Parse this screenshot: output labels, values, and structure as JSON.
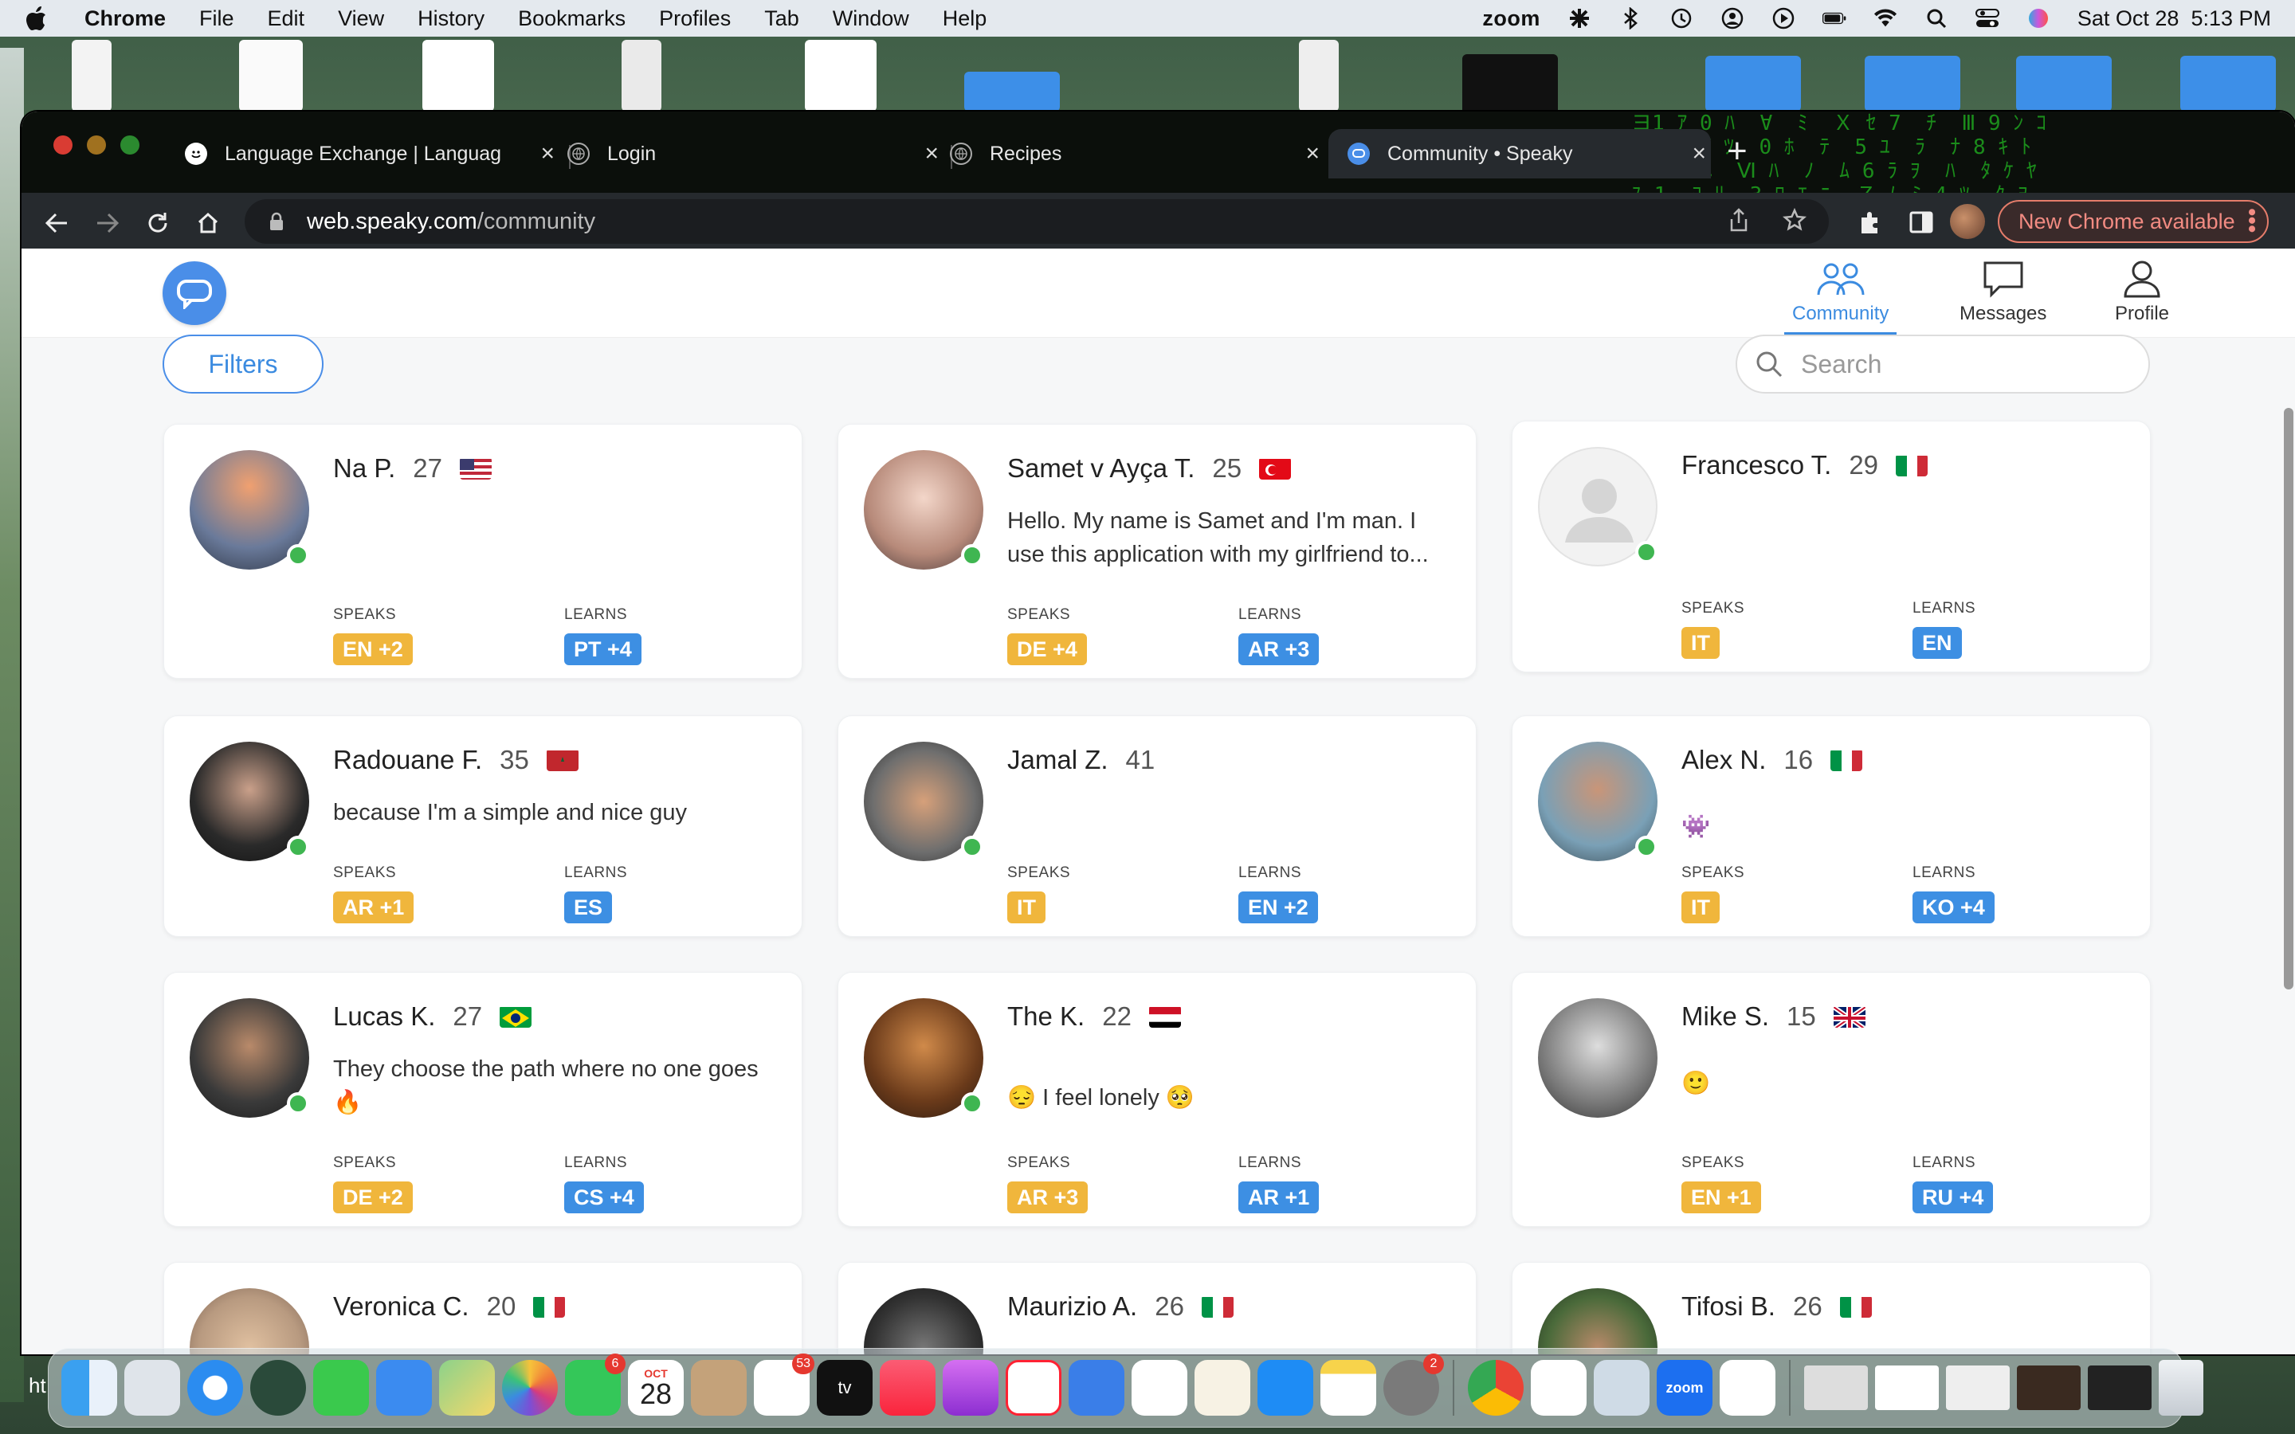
{
  "menubar": {
    "app": "Chrome",
    "items": [
      "File",
      "Edit",
      "View",
      "History",
      "Bookmarks",
      "Profiles",
      "Tab",
      "Window",
      "Help"
    ],
    "zoom_label": "zoom",
    "datetime": "Sat Oct 28  5:13 PM"
  },
  "browser": {
    "tabs": [
      {
        "title": "Language Exchange | Languag",
        "icon": "smiley-icon"
      },
      {
        "title": "Login",
        "icon": "globe-icon"
      },
      {
        "title": "Recipes",
        "icon": "globe-icon"
      },
      {
        "title": "Community • Speaky",
        "icon": "speaky-icon"
      }
    ],
    "url_host": "web.speaky.com",
    "url_path": "/community",
    "update_button": "New Chrome available"
  },
  "site": {
    "nav": {
      "community": "Community",
      "messages": "Messages",
      "profile": "Profile"
    },
    "filters_label": "Filters",
    "search_placeholder": "Search",
    "speaks_label": "SPEAKS",
    "learns_label": "LEARNS"
  },
  "profiles": [
    {
      "name": "Na P.",
      "age": "27",
      "flag": "us",
      "bio": "",
      "speaks": "EN +2",
      "learns": "PT +4",
      "online": true
    },
    {
      "name": "Samet v Ayça T.",
      "age": "25",
      "flag": "tr",
      "bio": "Hello. My name is Samet and I'm man. I use this application with my girlfriend to...",
      "speaks": "DE +4",
      "learns": "AR +3",
      "online": true
    },
    {
      "name": "Francesco T.",
      "age": "29",
      "flag": "it",
      "bio": "",
      "speaks": "IT",
      "learns": "EN",
      "online": true
    },
    {
      "name": "Radouane F.",
      "age": "35",
      "flag": "ma",
      "bio": "because I'm a simple and nice guy",
      "speaks": "AR +1",
      "learns": "ES",
      "online": true
    },
    {
      "name": "Jamal Z.",
      "age": "41",
      "flag": "",
      "bio": "",
      "speaks": "IT",
      "learns": "EN +2",
      "online": true
    },
    {
      "name": "Alex N.",
      "age": "16",
      "flag": "it",
      "bio": "👾",
      "speaks": "IT",
      "learns": "KO +4",
      "online": true
    },
    {
      "name": "Lucas K.",
      "age": "27",
      "flag": "br",
      "bio": "They choose the path where no one goes 🔥",
      "speaks": "DE +2",
      "learns": "CS +4",
      "online": true
    },
    {
      "name": "The K.",
      "age": "22",
      "flag": "eg",
      "bio": "😔 I feel lonely 🥺",
      "speaks": "AR +3",
      "learns": "AR +1",
      "online": true
    },
    {
      "name": "Mike S.",
      "age": "15",
      "flag": "gb",
      "bio": "🙂",
      "speaks": "EN +1",
      "learns": "RU +4",
      "online": false
    },
    {
      "name": "Veronica C.",
      "age": "20",
      "flag": "it",
      "bio": "",
      "speaks": "",
      "learns": "",
      "online": false
    },
    {
      "name": "Maurizio A.",
      "age": "26",
      "flag": "it",
      "bio": "",
      "speaks": "",
      "learns": "",
      "online": false
    },
    {
      "name": "Tifosi B.",
      "age": "26",
      "flag": "it",
      "bio": "",
      "speaks": "",
      "learns": "",
      "online": false
    }
  ],
  "dock": {
    "calendar_month": "OCT",
    "calendar_day": "28",
    "facetime_badge": "6",
    "reminders_badge": "53",
    "settings_badge": "2",
    "zoom_label": "zoom"
  },
  "status_hover": "ht"
}
